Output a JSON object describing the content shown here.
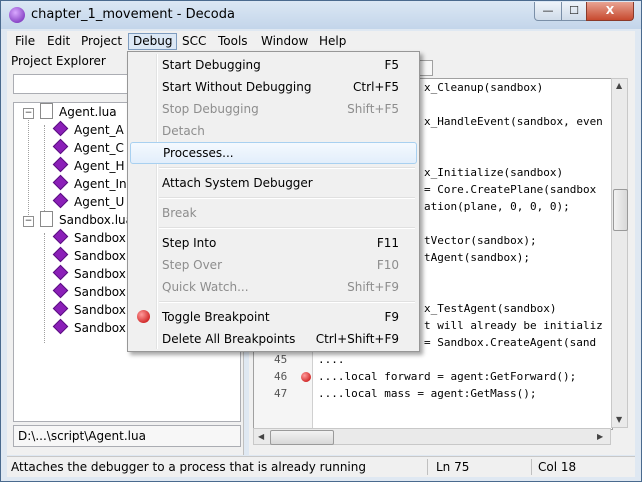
{
  "window": {
    "title": "chapter_1_movement - Decoda",
    "min_glyph": "—",
    "max_glyph": "☐",
    "close_glyph": "X"
  },
  "menubar": {
    "items": [
      {
        "id": "file",
        "label": "File"
      },
      {
        "id": "edit",
        "label": "Edit"
      },
      {
        "id": "project",
        "label": "Project"
      },
      {
        "id": "debug",
        "label": "Debug"
      },
      {
        "id": "scc",
        "label": "SCC"
      },
      {
        "id": "tools",
        "label": "Tools"
      },
      {
        "id": "window",
        "label": "Window"
      },
      {
        "id": "help",
        "label": "Help"
      }
    ]
  },
  "project_explorer": {
    "title": "Project Explorer",
    "search_value": "",
    "tree": {
      "files": [
        {
          "name": "Agent.lua",
          "expander": "−",
          "children": [
            "Agent_A",
            "Agent_C",
            "Agent_H",
            "Agent_In",
            "Agent_U"
          ]
        },
        {
          "name": "Sandbox.lua",
          "expander": "−",
          "children": [
            "Sandbox",
            "Sandbox",
            "Sandbox",
            "Sandbox",
            "Sandbox",
            "Sandbox"
          ]
        }
      ]
    },
    "path": "D:\\...\\script\\Agent.lua"
  },
  "editor": {
    "lines": [
      {
        "n": "",
        "code": "x_Cleanup(sandbox)",
        "bp": false
      },
      {
        "n": "",
        "code": "",
        "bp": false
      },
      {
        "n": "",
        "code": "x_HandleEvent(sandbox, even",
        "bp": false
      },
      {
        "n": "",
        "code": "",
        "bp": false
      },
      {
        "n": "",
        "code": "",
        "bp": false
      },
      {
        "n": "",
        "code": "x_Initialize(sandbox)",
        "bp": false
      },
      {
        "n": "",
        "code": "= Core.CreatePlane(sandbox",
        "bp": false
      },
      {
        "n": "",
        "code": "ation(plane, 0, 0, 0);",
        "bp": false
      },
      {
        "n": "",
        "code": "",
        "bp": false
      },
      {
        "n": "",
        "code": "tVector(sandbox);",
        "bp": false
      },
      {
        "n": "",
        "code": "tAgent(sandbox);",
        "bp": false
      },
      {
        "n": "",
        "code": "",
        "bp": false
      },
      {
        "n": "",
        "code": "",
        "bp": false
      },
      {
        "n": "",
        "code": "x_TestAgent(sandbox)",
        "bp": false
      },
      {
        "n": "",
        "code": "t will already be initializ",
        "bp": false
      },
      {
        "n": "44",
        "code": "....local agent = Sandbox.CreateAgent(sand",
        "bp": false
      },
      {
        "n": "45",
        "code": "....",
        "bp": false
      },
      {
        "n": "46",
        "code": "....local forward = agent:GetForward();",
        "bp": true
      },
      {
        "n": "47",
        "code": "....local mass = agent:GetMass();",
        "bp": false
      },
      {
        "n": "",
        "code": "",
        "bp": false
      }
    ]
  },
  "debug_menu": {
    "items": [
      {
        "type": "item",
        "id": "start-debugging",
        "label": "Start Debugging",
        "shortcut": "F5",
        "disabled": false
      },
      {
        "type": "item",
        "id": "start-without-debugging",
        "label": "Start Without Debugging",
        "shortcut": "Ctrl+F5",
        "disabled": false
      },
      {
        "type": "item",
        "id": "stop-debugging",
        "label": "Stop Debugging",
        "shortcut": "Shift+F5",
        "disabled": true
      },
      {
        "type": "item",
        "id": "detach",
        "label": "Detach",
        "shortcut": "",
        "disabled": true
      },
      {
        "type": "item",
        "id": "processes",
        "label": "Processes...",
        "shortcut": "",
        "disabled": false,
        "hover": true
      },
      {
        "type": "sep"
      },
      {
        "type": "item",
        "id": "attach-system-debugger",
        "label": "Attach System Debugger",
        "shortcut": "",
        "disabled": false
      },
      {
        "type": "sep"
      },
      {
        "type": "item",
        "id": "break",
        "label": "Break",
        "shortcut": "",
        "disabled": true
      },
      {
        "type": "sep"
      },
      {
        "type": "item",
        "id": "step-into",
        "label": "Step Into",
        "shortcut": "F11",
        "disabled": false
      },
      {
        "type": "item",
        "id": "step-over",
        "label": "Step Over",
        "shortcut": "F10",
        "disabled": true
      },
      {
        "type": "item",
        "id": "quick-watch",
        "label": "Quick Watch...",
        "shortcut": "Shift+F9",
        "disabled": true
      },
      {
        "type": "sep"
      },
      {
        "type": "item",
        "id": "toggle-breakpoint",
        "label": "Toggle Breakpoint",
        "shortcut": "F9",
        "disabled": false,
        "icon": "breakpoint-icon"
      },
      {
        "type": "item",
        "id": "delete-all-breakpoints",
        "label": "Delete All Breakpoints",
        "shortcut": "Ctrl+Shift+F9",
        "disabled": false
      }
    ]
  },
  "statusbar": {
    "message": "Attaches the debugger to a process that is already running",
    "line": "Ln 75",
    "col": "Col 18"
  },
  "colors": {
    "accent": "#3399ff",
    "breakpoint": "#c00000",
    "keyword": "#1a1aa6"
  }
}
